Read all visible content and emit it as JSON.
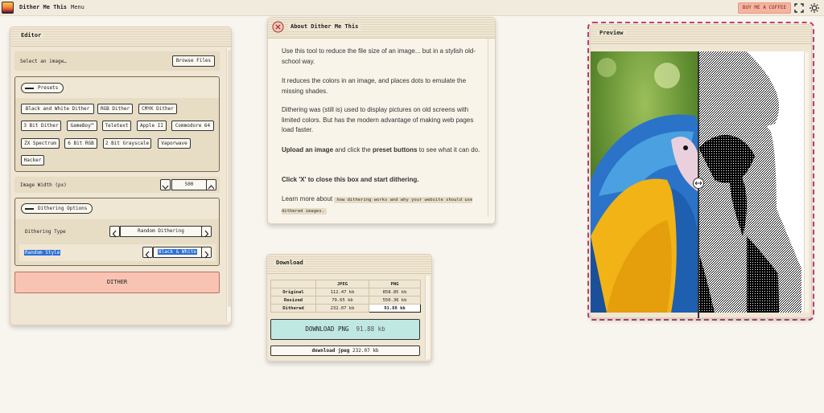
{
  "app": {
    "title": "Dither Me This",
    "menu_label": "Menu",
    "coffee_label": "BUY ME A COFFEE"
  },
  "icons": {
    "fullscreen": "fullscreen-icon",
    "theme": "sun-icon",
    "close": "close-circle-icon",
    "compare": "compare-handle-icon"
  },
  "editor": {
    "title": "Editor",
    "select_image_label": "Select an image…",
    "browse_label": "Browse Files",
    "presets_label": "Presets",
    "presets": [
      "Black and White Dither",
      "RGB Dither",
      "CMYK Dither",
      "3 Bit Dither",
      "GameBoy™",
      "Teletext",
      "Apple II",
      "Commodore 64",
      "ZX Spectrum",
      "6 Bit RGB",
      "2 Bit Grayscale",
      "Vaporwave",
      "Hacker"
    ],
    "image_width_label": "Image Width (px)",
    "image_width_value": "500",
    "dithering_options_label": "Dithering Options",
    "dithering_type_label": "Dithering Type",
    "dithering_type_value": "Random Dithering",
    "random_style_label": "Random Style",
    "random_style_value": "Black & White",
    "dither_button": "DITHER"
  },
  "about": {
    "title": "About Dither Me This",
    "p1": "Use this tool to reduce the file size of an image... but in a stylish old-school way.",
    "p2": "It reduces the colors in an image, and places dots to emulate the missing shades.",
    "p3": "Dithering was (still is) used to display pictures on old screens with limited colors. But has the modern advantage of making web pages load faster.",
    "p4_bold1": "Upload an image",
    "p4_mid": " and click the ",
    "p4_bold2": "preset buttons",
    "p4_end": " to see what it can do.",
    "p5": "Click 'X' to close this box and start dithering.",
    "p6_prefix": "Learn more about ",
    "p6_link": "how dithering works and why your website should use dithered images."
  },
  "download": {
    "title": "Download",
    "columns": [
      "",
      "JPEG",
      "PNG"
    ],
    "rows": [
      {
        "label": "Original",
        "jpeg": "112.47 kb",
        "png": "858.85 kb"
      },
      {
        "label": "Resized",
        "jpeg": "79.65 kb",
        "png": "550.36 kb"
      },
      {
        "label": "Dithered",
        "jpeg": "232.07 kb",
        "png": "91.88 kb"
      }
    ],
    "png_button_label": "DOWNLOAD PNG",
    "png_button_size": "91.88 kb",
    "jpeg_button_label": "download jpeg",
    "jpeg_button_size": "232.07 kb"
  },
  "preview": {
    "title": "Preview"
  },
  "colors": {
    "accent": "#c8406a",
    "coffee": "#f6b3a0",
    "dither_button": "#f9c3b3",
    "download_png": "#bfe8e2",
    "panel": "#efe6d3"
  }
}
